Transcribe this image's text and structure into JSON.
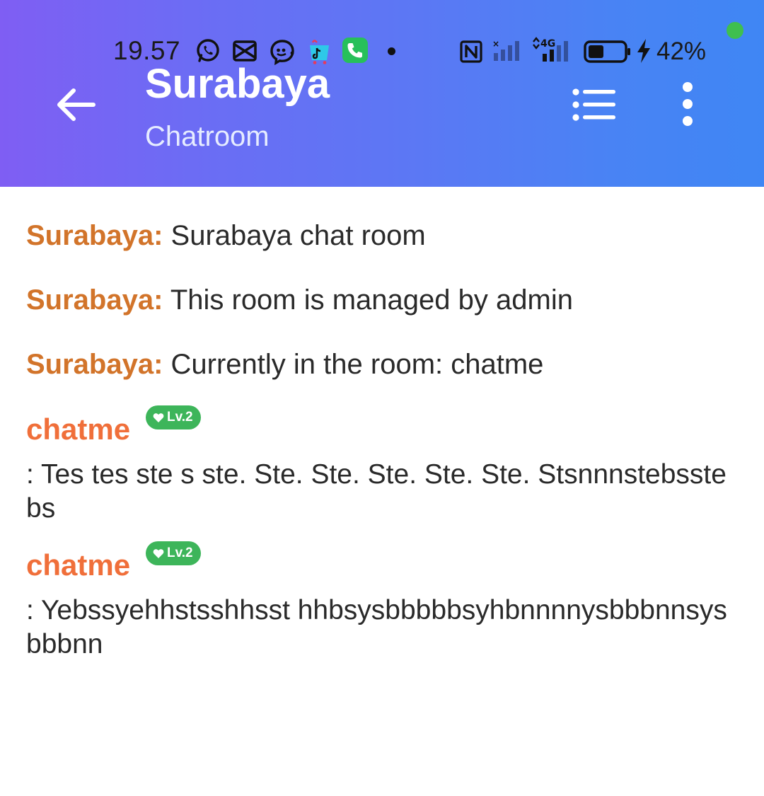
{
  "status_bar": {
    "time": "19.57",
    "battery_percent": "42%",
    "notification_icons": [
      "whatsapp-icon",
      "capcut-icon",
      "messenger-icon",
      "tiktok-shop-icon",
      "phone-call-icon"
    ],
    "system_icons": [
      "nfc-icon",
      "signal-no-service-icon",
      "signal-4g-icon",
      "battery-icon",
      "charging-bolt-icon"
    ]
  },
  "app_bar": {
    "title": "Surabaya",
    "subtitle": "Chatroom"
  },
  "messages": {
    "system": [
      {
        "sender": "Surabaya:",
        "text": " Surabaya chat room"
      },
      {
        "sender": "Surabaya:",
        "text": " This room is managed by admin"
      },
      {
        "sender": "Surabaya:",
        "text": " Currently in the room: chatme"
      }
    ],
    "user": [
      {
        "name": "chatme",
        "level": "Lv.2",
        "text": " : Tes tes ste s ste. Ste. Ste. Ste. Ste. Ste. Stsnnnstebsstebs"
      },
      {
        "name": "chatme",
        "level": "Lv.2",
        "text": " : Yebssyehhstsshhsst hhbsysbbbbbsyhbnnnnysbbbnnsysbbbnn"
      }
    ]
  },
  "colors": {
    "header_gradient_start": "#7f5ef3",
    "header_gradient_end": "#3f86f4",
    "system_sender": "#d2742a",
    "user_name": "#f06f3a",
    "level_badge": "#3db55a",
    "camera_indicator": "#3fbf4f"
  }
}
